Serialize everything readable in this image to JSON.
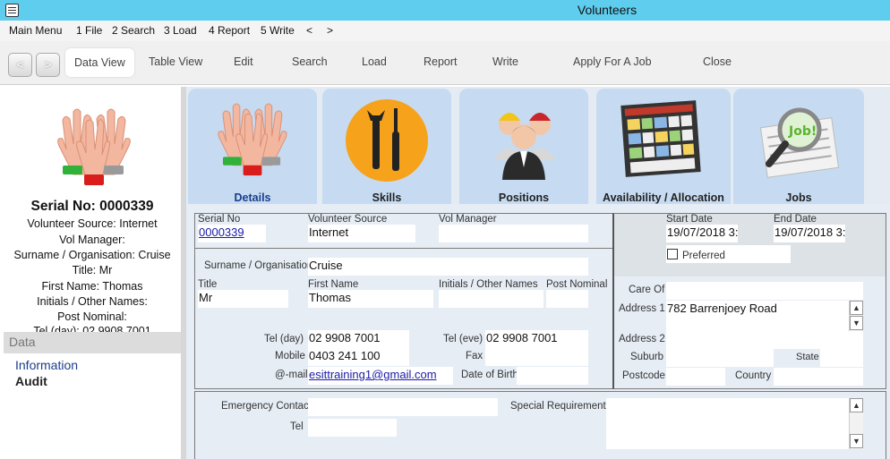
{
  "window": {
    "title": "Volunteers"
  },
  "menu": [
    "Main Menu",
    "1 File",
    "2 Search",
    "3 Load",
    "4 Report",
    "5 Write",
    "<",
    ">"
  ],
  "toolbar": {
    "back_icon": "<",
    "forward_icon": ">",
    "items": [
      "Data View",
      "Table View",
      "Edit",
      "Search",
      "Load",
      "Report",
      "Write",
      "Apply For A Job",
      "Close"
    ]
  },
  "summary": {
    "serial": "Serial No: 0000339",
    "lines": [
      "Volunteer Source: Internet",
      "Vol Manager:",
      "Surname / Organisation: Cruise",
      "Title: Mr",
      "First Name: Thomas",
      "Initials / Other Names:",
      "Post Nominal:",
      "Tel (day): 02 9908 7001"
    ]
  },
  "sidebar": {
    "header": "Data",
    "items": [
      "Information",
      "Audit"
    ]
  },
  "tabs": [
    "Details",
    "Skills",
    "Positions",
    "Availability / Allocation",
    "Jobs"
  ],
  "form": {
    "serial_label": "Serial No",
    "serial_value": "0000339",
    "source_label": "Volunteer Source",
    "source_value": "Internet",
    "manager_label": "Vol Manager",
    "manager_value": "",
    "surname_label": "Surname / Organisation",
    "surname_value": "Cruise",
    "title_label": "Title",
    "title_value": "Mr",
    "firstname_label": "First Name",
    "firstname_value": "Thomas",
    "initials_label": "Initials / Other Names",
    "initials_value": "",
    "postnominal_label": "Post Nominal",
    "postnominal_value": "",
    "telday_label": "Tel (day)",
    "telday_value": "02 9908 7001",
    "televe_label": "Tel (eve)",
    "televe_value": "02 9908 7001",
    "mobile_label": "Mobile",
    "mobile_value": "0403 241 100",
    "fax_label": "Fax",
    "fax_value": "",
    "email_label": "@-mail",
    "email_value": "esittraining1@gmail.com",
    "dob_label": "Date of Birth",
    "dob_value": "",
    "start_label": "Start Date",
    "start_value": "19/07/2018 3:",
    "end_label": "End Date",
    "end_value": "19/07/2018 3:",
    "preferred_label": "Preferred",
    "preferred_checked": false,
    "careof_label": "Care Of",
    "careof_value": "",
    "address1_label": "Address 1",
    "address1_value": "782 Barrenjoey Road",
    "address2_label": "Address 2",
    "address2_value": "",
    "suburb_label": "Suburb",
    "suburb_value": "",
    "state_label": "State",
    "state_value": "",
    "postcode_label": "Postcode",
    "postcode_value": "",
    "country_label": "Country",
    "country_value": "",
    "emergency_label": "Emergency Contact",
    "emergency_value": "",
    "emtel_label": "Tel",
    "emtel_value": "",
    "special_label": "Special Requirements",
    "special_value": ""
  }
}
